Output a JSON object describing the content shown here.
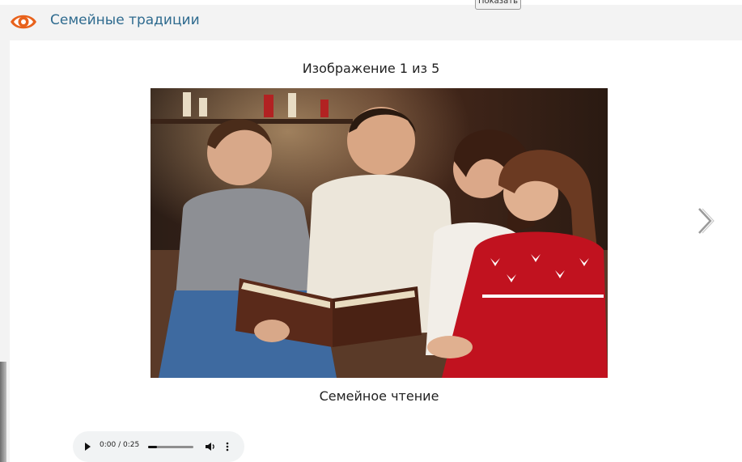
{
  "header": {
    "title": "Семейные традиции",
    "logo_icon": "eye-icon",
    "show_button_label": "Показать"
  },
  "gallery": {
    "counter_text": "Изображение 1 из 5",
    "caption": "Семейное чтение",
    "next_icon": "chevron-right-icon"
  },
  "audio": {
    "time_text": "0:00 / 0:25",
    "progress_fraction": 0.0,
    "play_icon": "play-icon",
    "volume_icon": "volume-icon",
    "more_icon": "more-vertical-icon"
  },
  "colors": {
    "logo_orange": "#e8621c",
    "title_blue": "#2f6b8f",
    "header_bg": "#f3f3f3"
  }
}
